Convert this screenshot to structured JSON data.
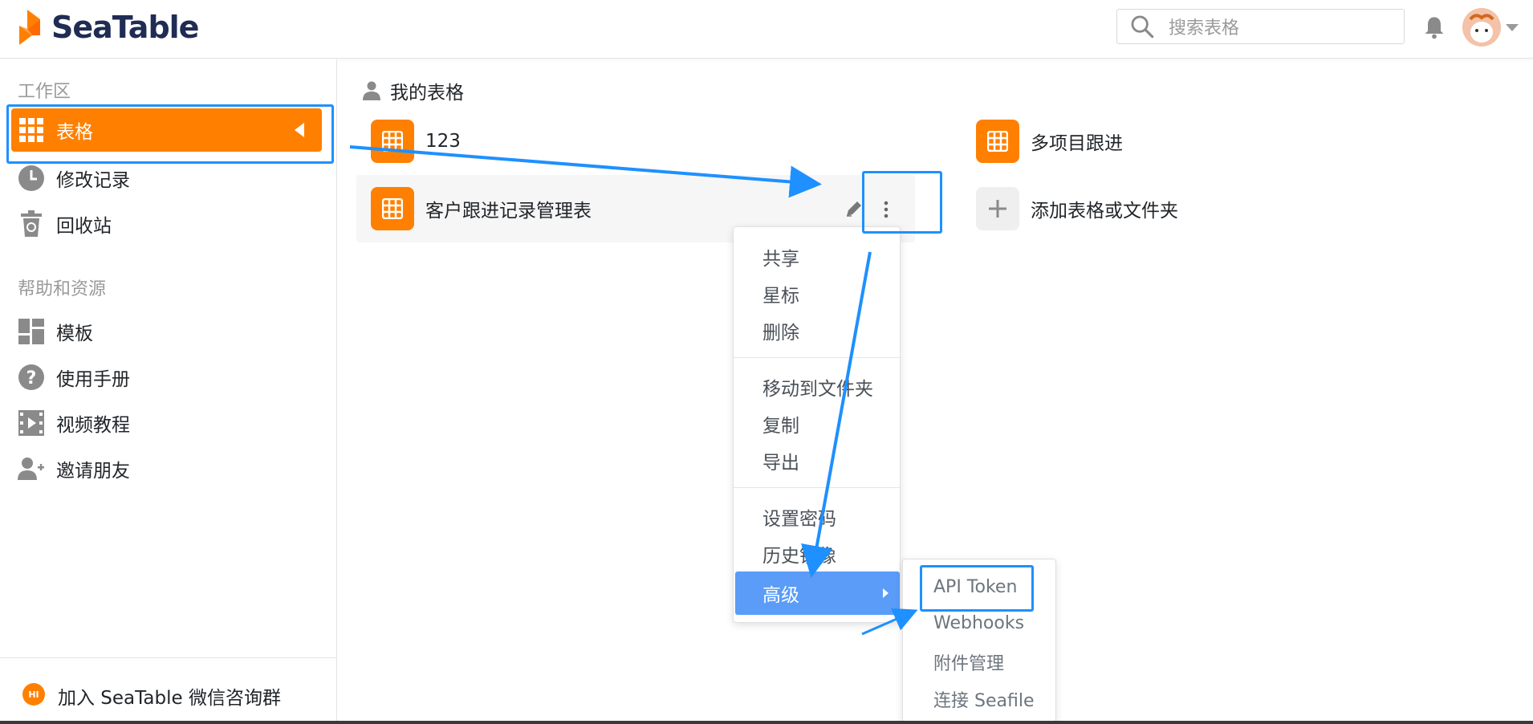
{
  "header": {
    "logo_text": "SeaTable",
    "search_placeholder": "搜索表格"
  },
  "sidebar": {
    "workspace_title": "工作区",
    "workspace_items": [
      {
        "label": "表格",
        "icon": "grid-icon",
        "active": true
      },
      {
        "label": "修改记录",
        "icon": "clock-icon"
      },
      {
        "label": "回收站",
        "icon": "trash-icon"
      }
    ],
    "help_title": "帮助和资源",
    "help_items": [
      {
        "label": "模板",
        "icon": "template-icon"
      },
      {
        "label": "使用手册",
        "icon": "question-icon"
      },
      {
        "label": "视频教程",
        "icon": "video-icon"
      },
      {
        "label": "邀请朋友",
        "icon": "add-user-icon"
      }
    ],
    "footer_badge": "HI",
    "footer_label": "加入 SeaTable 微信咨询群"
  },
  "main": {
    "section_title": "我的表格",
    "tables": [
      {
        "name": "123"
      },
      {
        "name": "客户跟进记录管理表"
      },
      {
        "name": "多项目跟进"
      }
    ],
    "add_label": "添加表格或文件夹"
  },
  "context_menu": {
    "group1": [
      "共享",
      "星标",
      "删除"
    ],
    "group2": [
      "移动到文件夹",
      "复制",
      "导出"
    ],
    "group3": [
      "设置密码",
      "历史镜像"
    ],
    "advanced": "高级"
  },
  "submenu": {
    "items": [
      "API Token",
      "Webhooks",
      "附件管理",
      "连接 Seafile"
    ]
  },
  "colors": {
    "brand_orange": "#ff8000",
    "menu_active_blue": "#5a9cf8",
    "annotation_blue": "#1e90ff"
  }
}
